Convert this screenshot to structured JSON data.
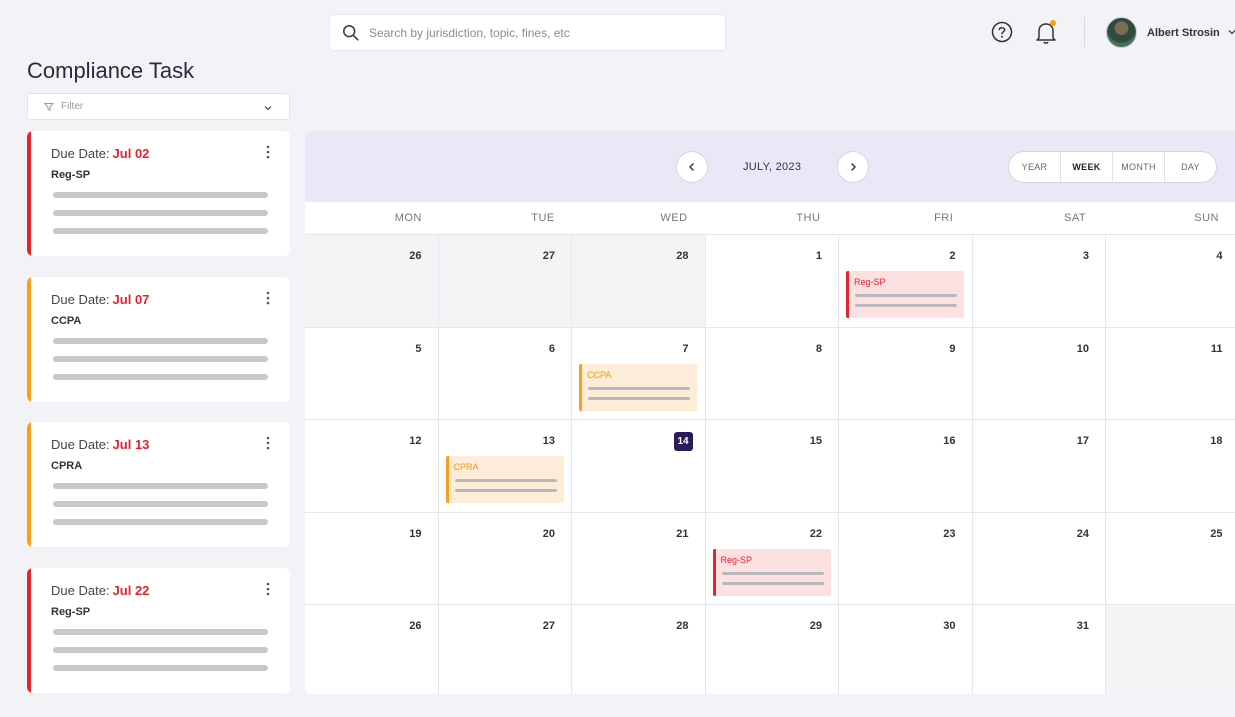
{
  "search": {
    "placeholder": "Search by jurisdiction, topic, fines, etc"
  },
  "user": {
    "name": "Albert Strosin"
  },
  "page": {
    "title": "Compliance Task"
  },
  "filter": {
    "label": "Filter"
  },
  "tasks": [
    {
      "due_label": "Due Date:",
      "date": "Jul 02",
      "name": "Reg-SP",
      "color": "#e5232f"
    },
    {
      "due_label": "Due Date:",
      "date": "Jul 07",
      "name": "CCPA",
      "color": "#f7a11b"
    },
    {
      "due_label": "Due Date:",
      "date": "Jul 13",
      "name": "CPRA",
      "color": "#f7a11b"
    },
    {
      "due_label": "Due Date:",
      "date": "Jul 22",
      "name": "Reg-SP",
      "color": "#e5232f"
    }
  ],
  "calendar": {
    "month_label": "JULY, 2023",
    "views": [
      "YEAR",
      "WEEK",
      "MONTH",
      "DAY"
    ],
    "active_view": "WEEK",
    "days_of_week": [
      "MON",
      "TUE",
      "WED",
      "THU",
      "FRI",
      "SAT",
      "SUN"
    ],
    "weeks": [
      [
        "26",
        "27",
        "28",
        "1",
        "2",
        "3",
        "4"
      ],
      [
        "5",
        "6",
        "7",
        "8",
        "9",
        "10",
        "11"
      ],
      [
        "12",
        "13",
        "14",
        "15",
        "16",
        "17",
        "18"
      ],
      [
        "19",
        "20",
        "21",
        "22",
        "23",
        "24",
        "25"
      ],
      [
        "26",
        "27",
        "28",
        "29",
        "30",
        "31",
        ""
      ]
    ],
    "today": "14",
    "events": [
      {
        "title": "Reg-SP",
        "week": 0,
        "day": 4,
        "color": "red"
      },
      {
        "title": "CCPA",
        "week": 1,
        "day": 2,
        "color": "orange"
      },
      {
        "title": "CPRA",
        "week": 2,
        "day": 1,
        "color": "orange"
      },
      {
        "title": "Reg-SP",
        "week": 3,
        "day": 3,
        "color": "red"
      }
    ]
  },
  "colors": {
    "accent_red": "#e5232f",
    "accent_orange": "#f7a11b",
    "today_bg": "#2a1a5e",
    "header_bg": "#e9e8f7"
  }
}
